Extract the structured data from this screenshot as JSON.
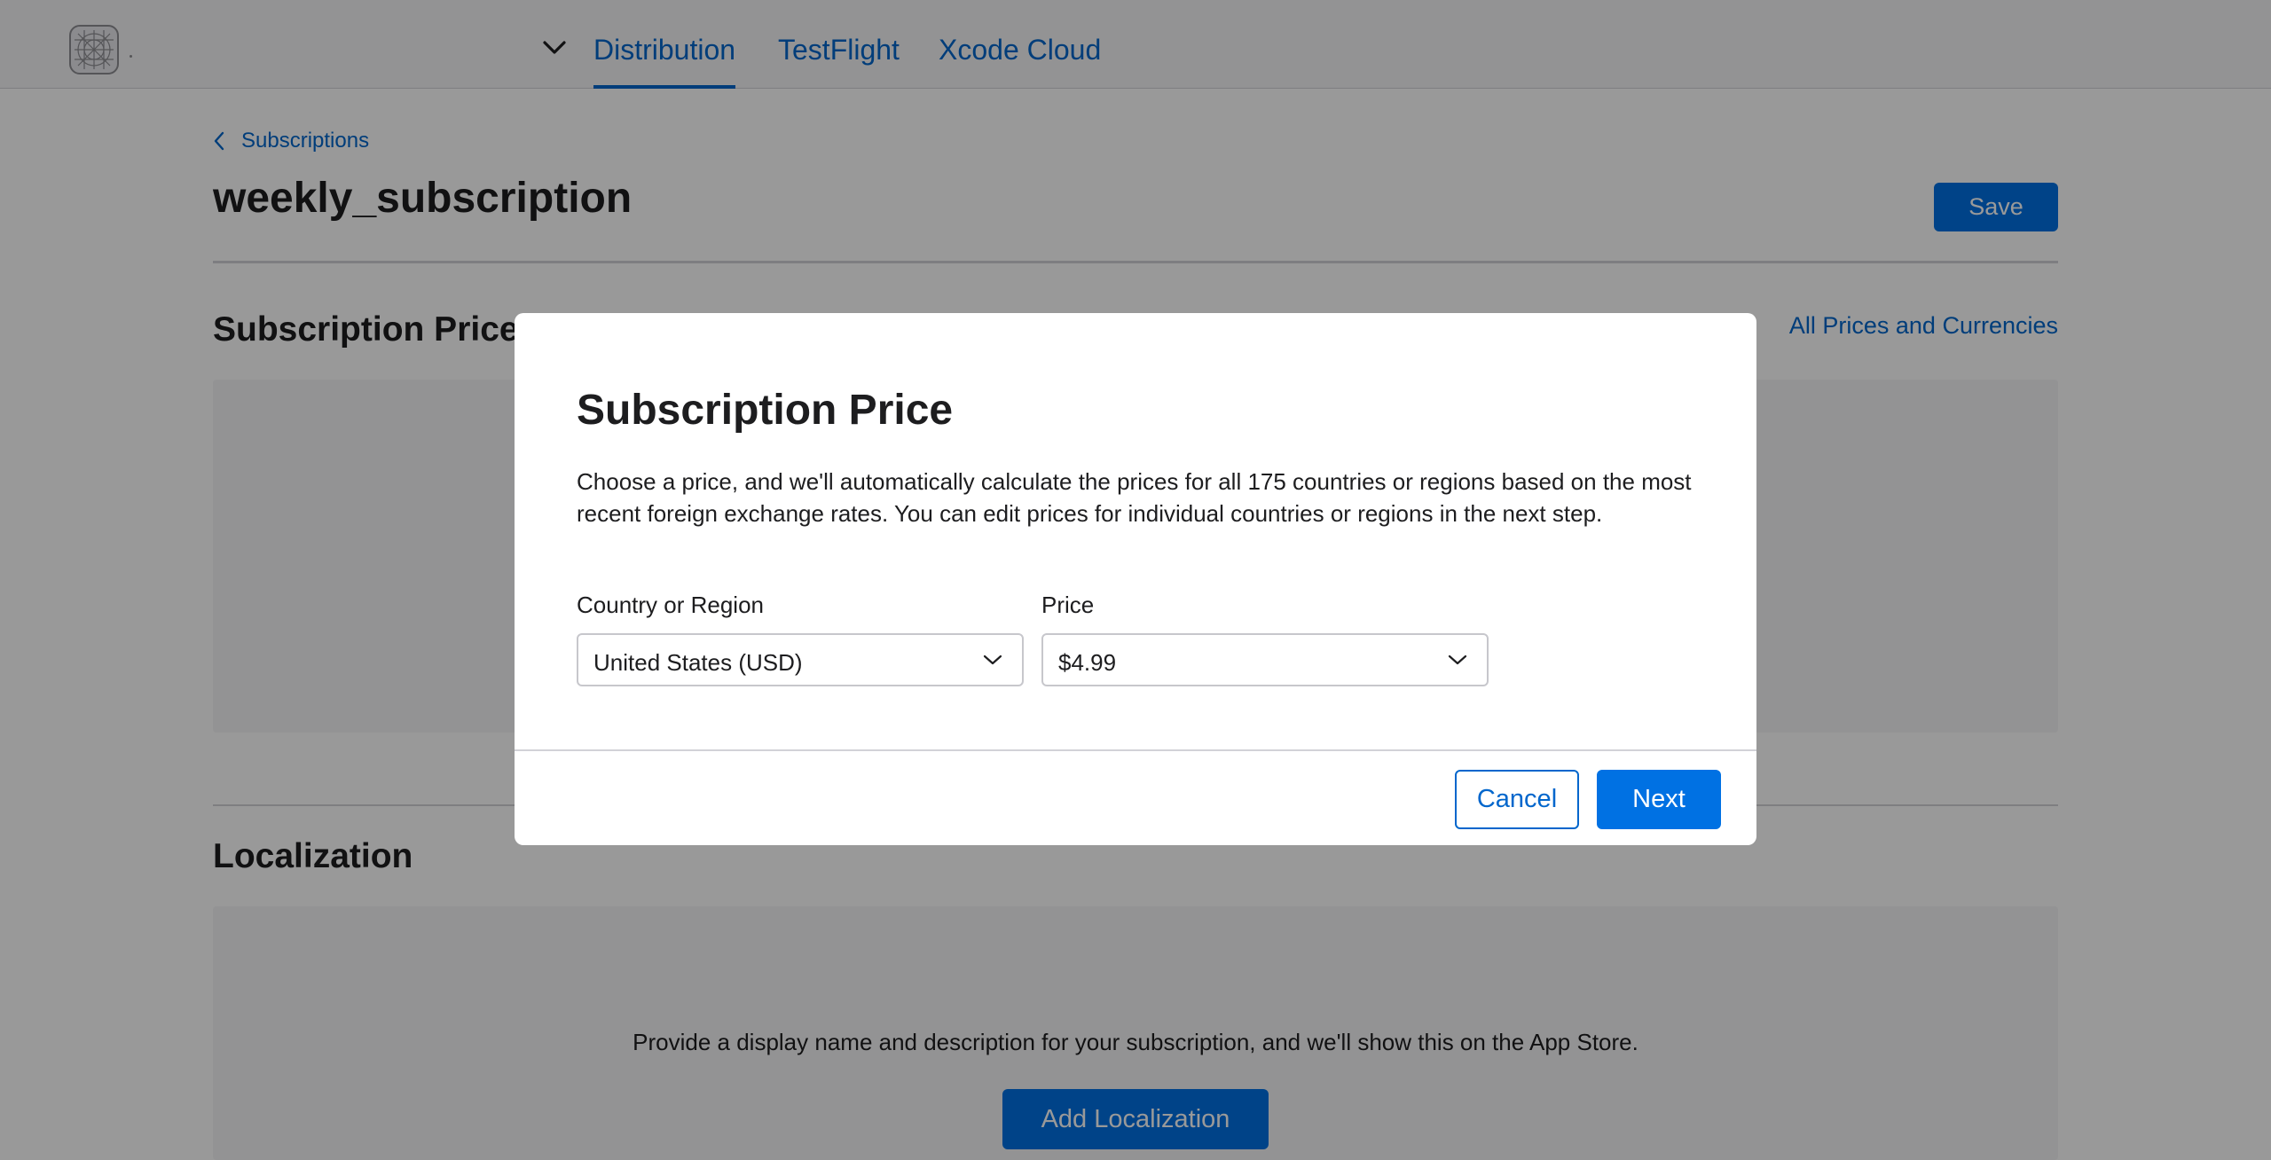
{
  "topbar": {
    "tabs": [
      {
        "label": "Distribution",
        "active": true
      },
      {
        "label": "TestFlight",
        "active": false
      },
      {
        "label": "Xcode Cloud",
        "active": false
      }
    ]
  },
  "breadcrumb": {
    "label": "Subscriptions"
  },
  "page": {
    "title": "weekly_subscription",
    "save_label": "Save"
  },
  "pricing_section": {
    "title": "Subscription Price",
    "all_prices_link": "All Prices and Currencies"
  },
  "localization_section": {
    "title": "Localization",
    "empty_text": "Provide a display name and description for your subscription, and we'll show this on the App Store.",
    "add_button": "Add Localization"
  },
  "modal": {
    "title": "Subscription Price",
    "description": "Choose a price, and we'll automatically calculate the prices for all 175 countries or regions based on the most recent foreign exchange rates. You can edit prices for individual countries or regions in the next step.",
    "country_label": "Country or Region",
    "country_value": "United States (USD)",
    "price_label": "Price",
    "price_value": "$4.99",
    "cancel_label": "Cancel",
    "next_label": "Next"
  },
  "colors": {
    "accent": "#0071e3",
    "link": "#0066cc",
    "overlay": "rgba(0,0,0,0.40)"
  },
  "icons": [
    "app-logo-icon",
    "chevron-down-icon",
    "chevron-left-icon"
  ]
}
